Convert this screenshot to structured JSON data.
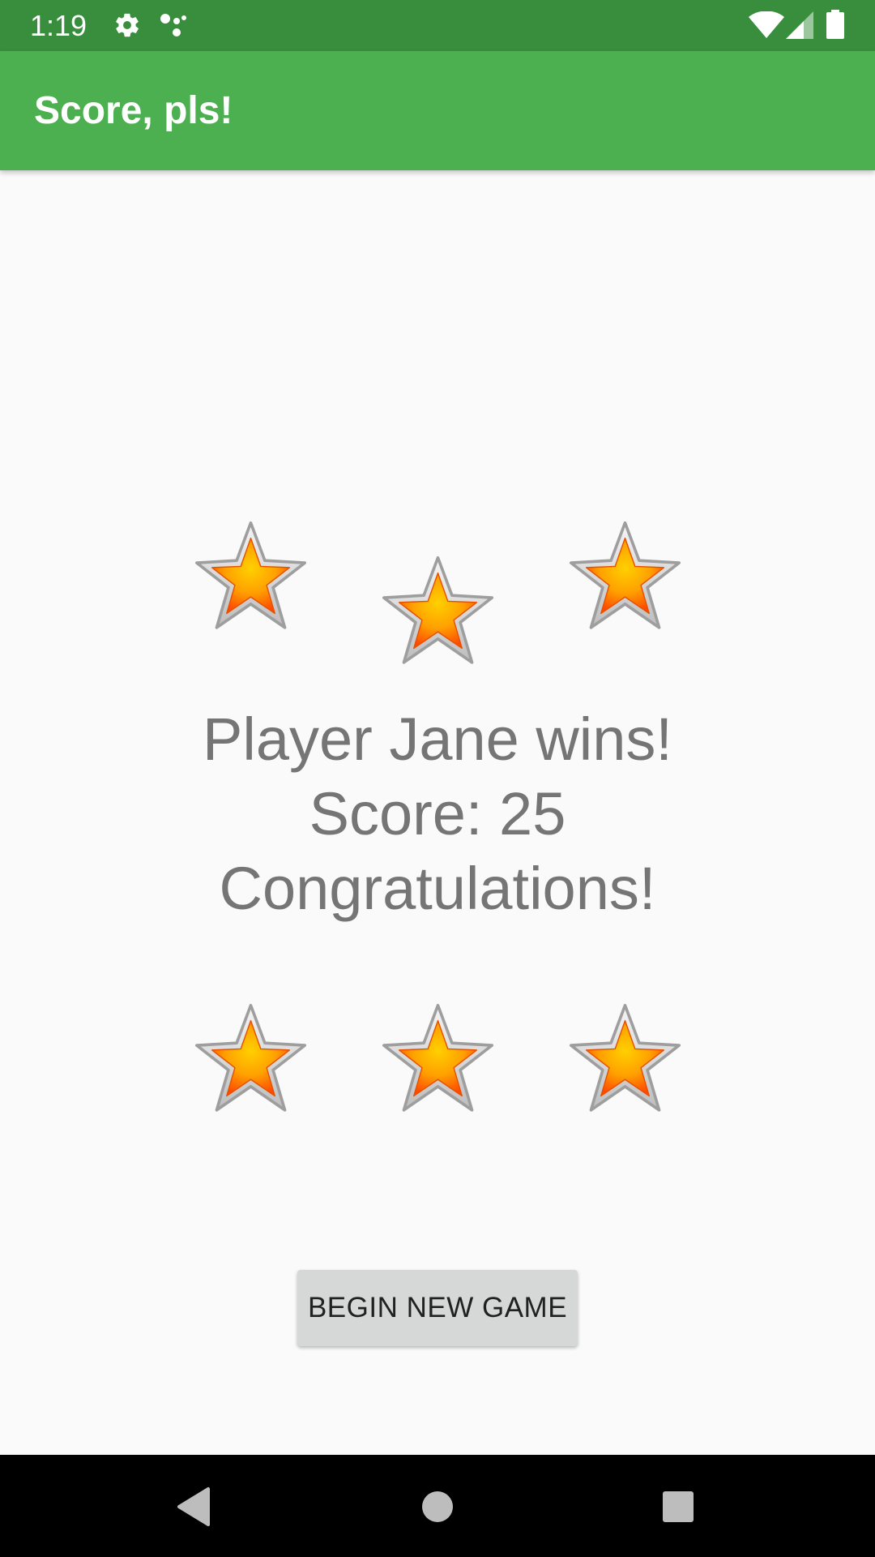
{
  "status_bar": {
    "time": "1:19",
    "icons": [
      "settings-icon",
      "assistant-dots-icon",
      "wifi-icon",
      "signal-icon",
      "battery-icon"
    ],
    "background": "#388e3c"
  },
  "app_bar": {
    "title": "Score, pls!",
    "background": "#4caf50"
  },
  "stars": {
    "icon": "star-icon",
    "count_top": 3,
    "count_bottom": 3
  },
  "message": {
    "line1": "Player Jane wins!",
    "line2": "Score: 25",
    "line3": "Congratulations!",
    "color": "#757575"
  },
  "button": {
    "label": "BEGIN NEW GAME"
  },
  "nav_bar": {
    "icons": [
      "back-icon",
      "home-icon",
      "recents-icon"
    ]
  }
}
